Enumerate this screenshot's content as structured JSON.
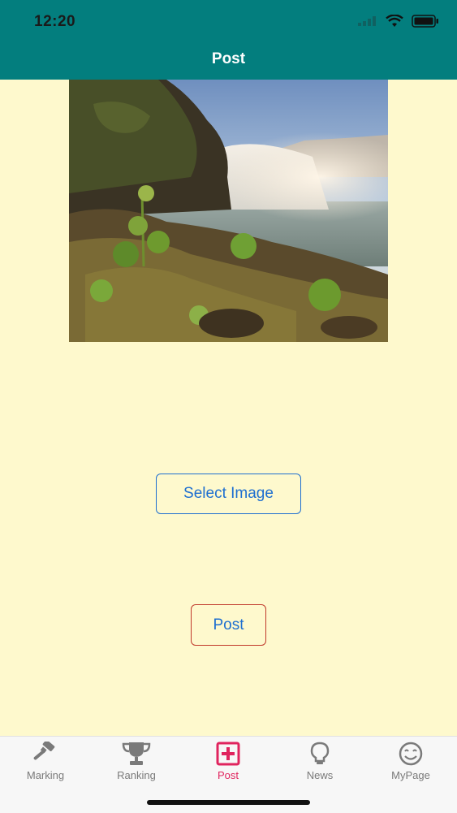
{
  "status_bar": {
    "time": "12:20"
  },
  "header": {
    "title": "Post"
  },
  "photo": {
    "description": "waterfall-landscape"
  },
  "buttons": {
    "select_image": "Select Image",
    "post": "Post"
  },
  "tabbar": {
    "items": [
      {
        "label": "Marking",
        "icon": "gavel-icon",
        "active": false
      },
      {
        "label": "Ranking",
        "icon": "trophy-icon",
        "active": false
      },
      {
        "label": "Post",
        "icon": "plus-square-icon",
        "active": true
      },
      {
        "label": "News",
        "icon": "lightbulb-icon",
        "active": false
      },
      {
        "label": "MyPage",
        "icon": "smiley-icon",
        "active": false
      }
    ]
  },
  "colors": {
    "header": "#037E7E",
    "background": "#FEF9CD",
    "button_text": "#1E6FD0",
    "post_border": "#C0392B",
    "active_tab": "#E0245E"
  }
}
